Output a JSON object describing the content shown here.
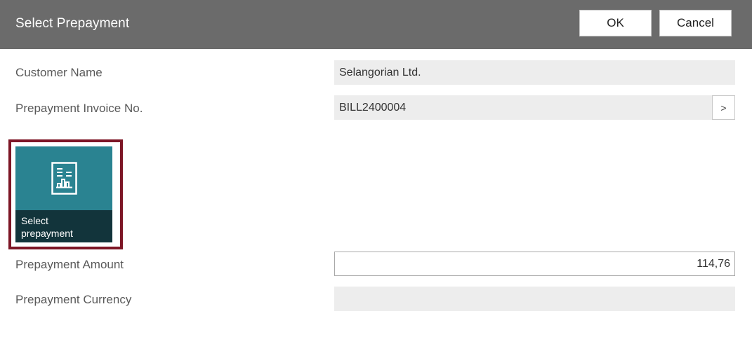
{
  "dialog": {
    "title": "Select Prepayment",
    "ok_label": "OK",
    "cancel_label": "Cancel"
  },
  "fields": {
    "customer_name": {
      "label": "Customer Name",
      "value": "Selangorian Ltd."
    },
    "prepayment_invoice_no": {
      "label": "Prepayment Invoice No.",
      "value": "BILL2400004",
      "lookup_label": ">"
    },
    "prepayment_amount": {
      "label": "Prepayment Amount",
      "value": "114,76"
    },
    "prepayment_currency": {
      "label": "Prepayment Currency",
      "value": ""
    }
  },
  "action_tile": {
    "label_line1": "Select",
    "label_line2": "prepayment",
    "icon": "report-document-icon"
  },
  "colors": {
    "header_bg": "#6b6b6b",
    "tile_bg": "#2a8391",
    "tile_caption_bg": "#12343b",
    "highlight_border": "#7d1626",
    "field_bg": "#ededed"
  }
}
